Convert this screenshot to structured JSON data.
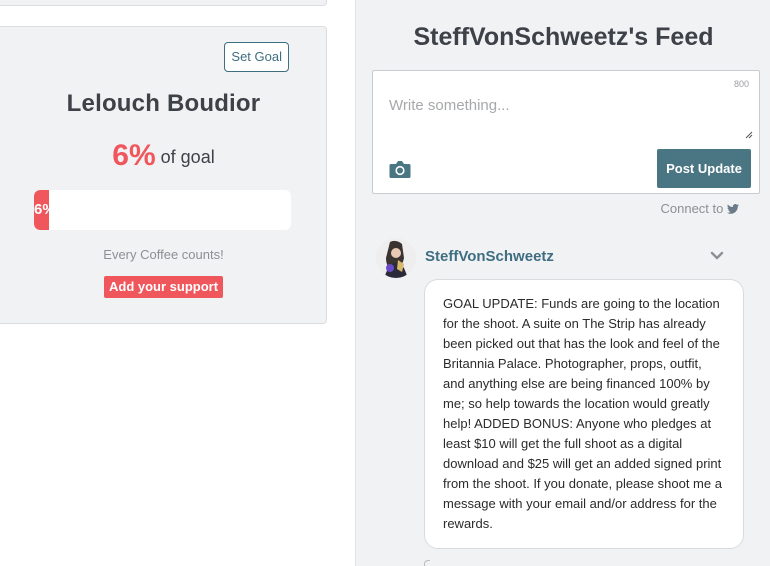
{
  "goal": {
    "set_goal_label": "Set Goal",
    "title": "Lelouch Boudior",
    "percent_text": "6%",
    "percent_suffix": "of goal",
    "progress_fraction": 0.06,
    "progress_label": "6%",
    "tagline": "Every Coffee counts!",
    "support_label": "Add your support"
  },
  "feed": {
    "title": "SteffVonSchweetz's Feed",
    "composer": {
      "placeholder": "Write something...",
      "char_limit": "800",
      "post_label": "Post Update",
      "camera_icon": "camera-icon"
    },
    "connect_label": "Connect to",
    "connect_icon": "twitter-icon",
    "post": {
      "author": "SteffVonSchweetz",
      "body": "GOAL UPDATE: Funds are going to the location for the shoot. A suite on The Strip has already been picked out that has the look and feel of the Britannia Palace. Photographer, props, outfit, and anything else are being financed 100% by me; so help towards the location would greatly help! ADDED BONUS: Anyone who pledges at least $10 will get the full shoot as a digital download and $25 will get an added signed print from the shoot. If you donate, please shoot me a message with your email and/or address for the rewards."
    }
  },
  "colors": {
    "accent_red": "#f0575c",
    "accent_teal": "#4a7684",
    "link_blue": "#3f6e82"
  }
}
